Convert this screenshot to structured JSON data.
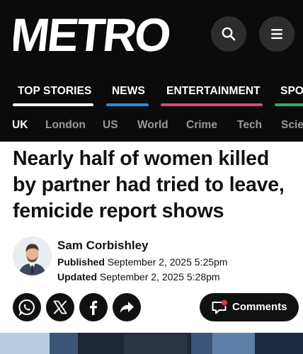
{
  "header": {
    "logo_text": "METRO",
    "search_icon": "search-icon",
    "menu_icon": "hamburger-menu-icon"
  },
  "main_nav": {
    "items": [
      {
        "label": "TOP STORIES",
        "color": "#ffffff"
      },
      {
        "label": "NEWS",
        "color": "#1f8ce6"
      },
      {
        "label": "ENTERTAINMENT",
        "color": "#e0457b"
      },
      {
        "label": "SPO",
        "color": "#27b36e"
      }
    ]
  },
  "sub_nav": {
    "items": [
      {
        "label": "UK",
        "active": true
      },
      {
        "label": "London"
      },
      {
        "label": "US"
      },
      {
        "label": "World"
      },
      {
        "label": "Crime"
      },
      {
        "label": "Tech"
      },
      {
        "label": "Scie"
      }
    ]
  },
  "article": {
    "headline": "Nearly half of women killed by partner had tried to leave, femicide report shows",
    "author": "Sam Corbishley",
    "published_label": "Published",
    "published_value": "September 2, 2025 5:25pm",
    "updated_label": "Updated",
    "updated_value": "September 2, 2025 5:28pm"
  },
  "share": {
    "icons": [
      "whatsapp-icon",
      "x-icon",
      "facebook-icon",
      "share-arrow-icon"
    ]
  },
  "comments": {
    "label": "Comments",
    "icon": "comment-bubble-icon",
    "badge_color": "#e8333a"
  },
  "colors": {
    "background_dark": "#0b0b0b",
    "button_dark": "#2d2d2d",
    "text": "#111111",
    "muted_nav": "#9a9a9a"
  }
}
